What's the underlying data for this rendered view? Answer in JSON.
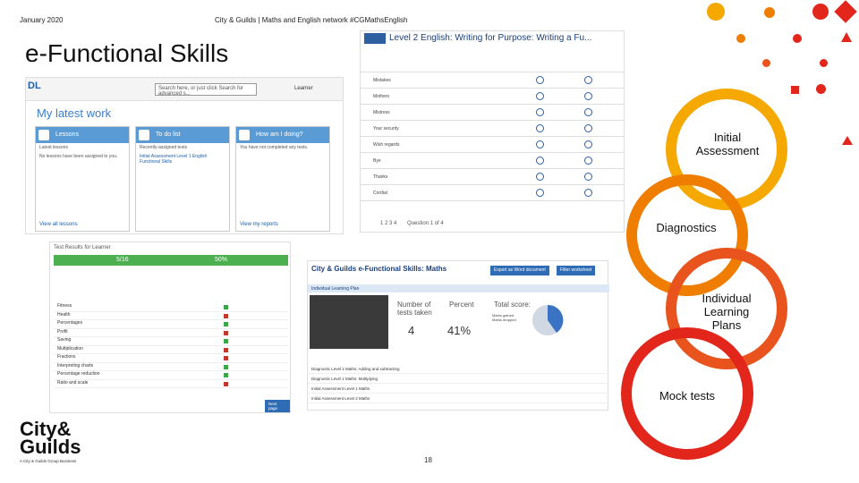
{
  "header": {
    "date": "January 2020",
    "tagline": "City & Guilds | Maths and English network #CGMathsEnglish"
  },
  "title": "e-Functional Skills",
  "page_number": "18",
  "flow": {
    "steps": [
      "Initial Assessment",
      "Diagnostics",
      "Individual Learning Plans",
      "Mock tests"
    ],
    "colors": [
      "#f5a800",
      "#ef7d00",
      "#e8531e",
      "#e2261c"
    ]
  },
  "brand": {
    "name_line1": "City&",
    "name_line2": "Guilds",
    "sub": "A City & Guilds Group Business"
  },
  "screen1": {
    "logo": "DL",
    "search_placeholder": "Search here, or just click Search for advanced s...",
    "learner": "Learner",
    "heading": "My latest work",
    "cards": [
      {
        "title": "Lessons",
        "sub": "Latest lessons",
        "body": "No lessons have been assigned to you.",
        "footer": "View all lessons"
      },
      {
        "title": "To do list",
        "sub": "Recently-assigned tests",
        "body": "Initial Assessment Level 1 English Functional Skills",
        "footer": ""
      },
      {
        "title": "How am I doing?",
        "sub": "",
        "body": "You have not completed any tests.",
        "footer": "View my reports"
      }
    ]
  },
  "screen2": {
    "title": "Level 2 English: Writing for Purpose: Writing a Fu...",
    "items": [
      "Mistakes",
      "Mothers",
      "Mistress",
      "Your security",
      "Wish regards",
      "Bye",
      "Thanks",
      "Cordial"
    ],
    "pager": "1 2 3 4",
    "question": "Question 1 of 4"
  },
  "screen3": {
    "title": "Test Results for Learner",
    "score": "5/16",
    "percent": "50%",
    "rows": [
      "Fitness",
      "Health",
      "Percentages",
      "Profit",
      "Saving",
      "Multiplication",
      "Fractions",
      "Interpreting charts",
      "Percentage reduction",
      "Ratio and scale"
    ],
    "status": [
      "pass",
      "fail",
      "pass",
      "fail",
      "pass",
      "fail",
      "fail",
      "pass",
      "pass",
      "fail"
    ],
    "button": "Next page"
  },
  "screen4": {
    "title": "City & Guilds e-Functional Skills: Maths",
    "btn1": "Export as Word document",
    "btn2": "Filter worksheet",
    "plan_label": "Individual Learning Plan",
    "tests_label": "Number of tests taken",
    "tests_value": "4",
    "percent_label": "Percent",
    "percent_value": "41%",
    "score_label": "Total score:",
    "legend": [
      "Marks gained",
      "Marks dropped"
    ],
    "rows": [
      "Diagnostic Level 1 Maths: Adding and subtracting",
      "Diagnostic Level 1 Maths: Multiplying",
      "Initial Assessment Level 1 Maths",
      "Initial Assessment Level 2 Maths"
    ]
  }
}
